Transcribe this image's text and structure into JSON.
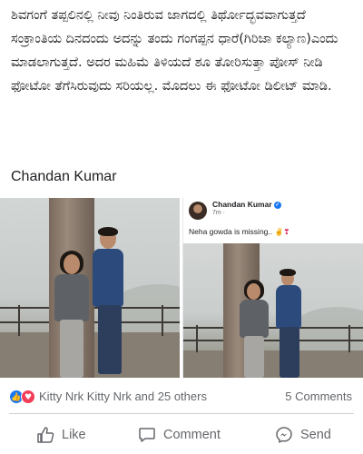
{
  "post": {
    "text": "ಶಿವಗಂಗೆ ತಪ್ಪಲಿನಲ್ಲಿ ನೀವು ನಿಂತಿರುವ ಜಾಗದಲ್ಲಿ ತಿರ್ಥೋದ್ಭವವಾಗುತ್ತದೆ ಸಂಕ್ರಾಂತಿಯ ದಿನದಂದು ಅದನ್ನು ತಂದು ಗಂಗಪ್ಪನ ಧಾರೆ(ಗಿರಿಜಾ ಕಲ್ಯಾಣ)ಎಂದು ಮಾಡಲಾಗುತ್ತದೆ. ಅದರ ಮಹಿಮೆ ತಿಳಿಯದೆ ಶೂ ತೋರಿಸುತ್ತಾ ಪೋಸ್ ನೀಡಿ ಫೋಟೋ ತೆಗೆಸಿರುವುದು ಸರಿಯಲ್ಲ. ಮೊದಲು ಈ ಫೋಟೋ ಡಿಲೀಟ್ ಮಾಡಿ.",
    "author": "Chandan Kumar"
  },
  "embedded_post": {
    "name": "Chandan Kumar",
    "verified_glyph": "✓",
    "time": "7m · ",
    "caption": "Neha gowda is missing..",
    "caption_emoji": "✌❣"
  },
  "reactions": {
    "like_glyph": "👍",
    "love_glyph": "♥",
    "text": "Kitty Nrk Kitty Nrk and 25 others",
    "comments": "5 Comments"
  },
  "actions": {
    "like": "Like",
    "comment": "Comment",
    "send": "Send"
  },
  "icons": {
    "like": "thumbs-up-icon",
    "comment": "comment-bubble-icon",
    "send": "messenger-icon"
  },
  "colors": {
    "brand_blue": "#1877f2",
    "love_red": "#f33e58",
    "secondary_text": "#65676b"
  }
}
